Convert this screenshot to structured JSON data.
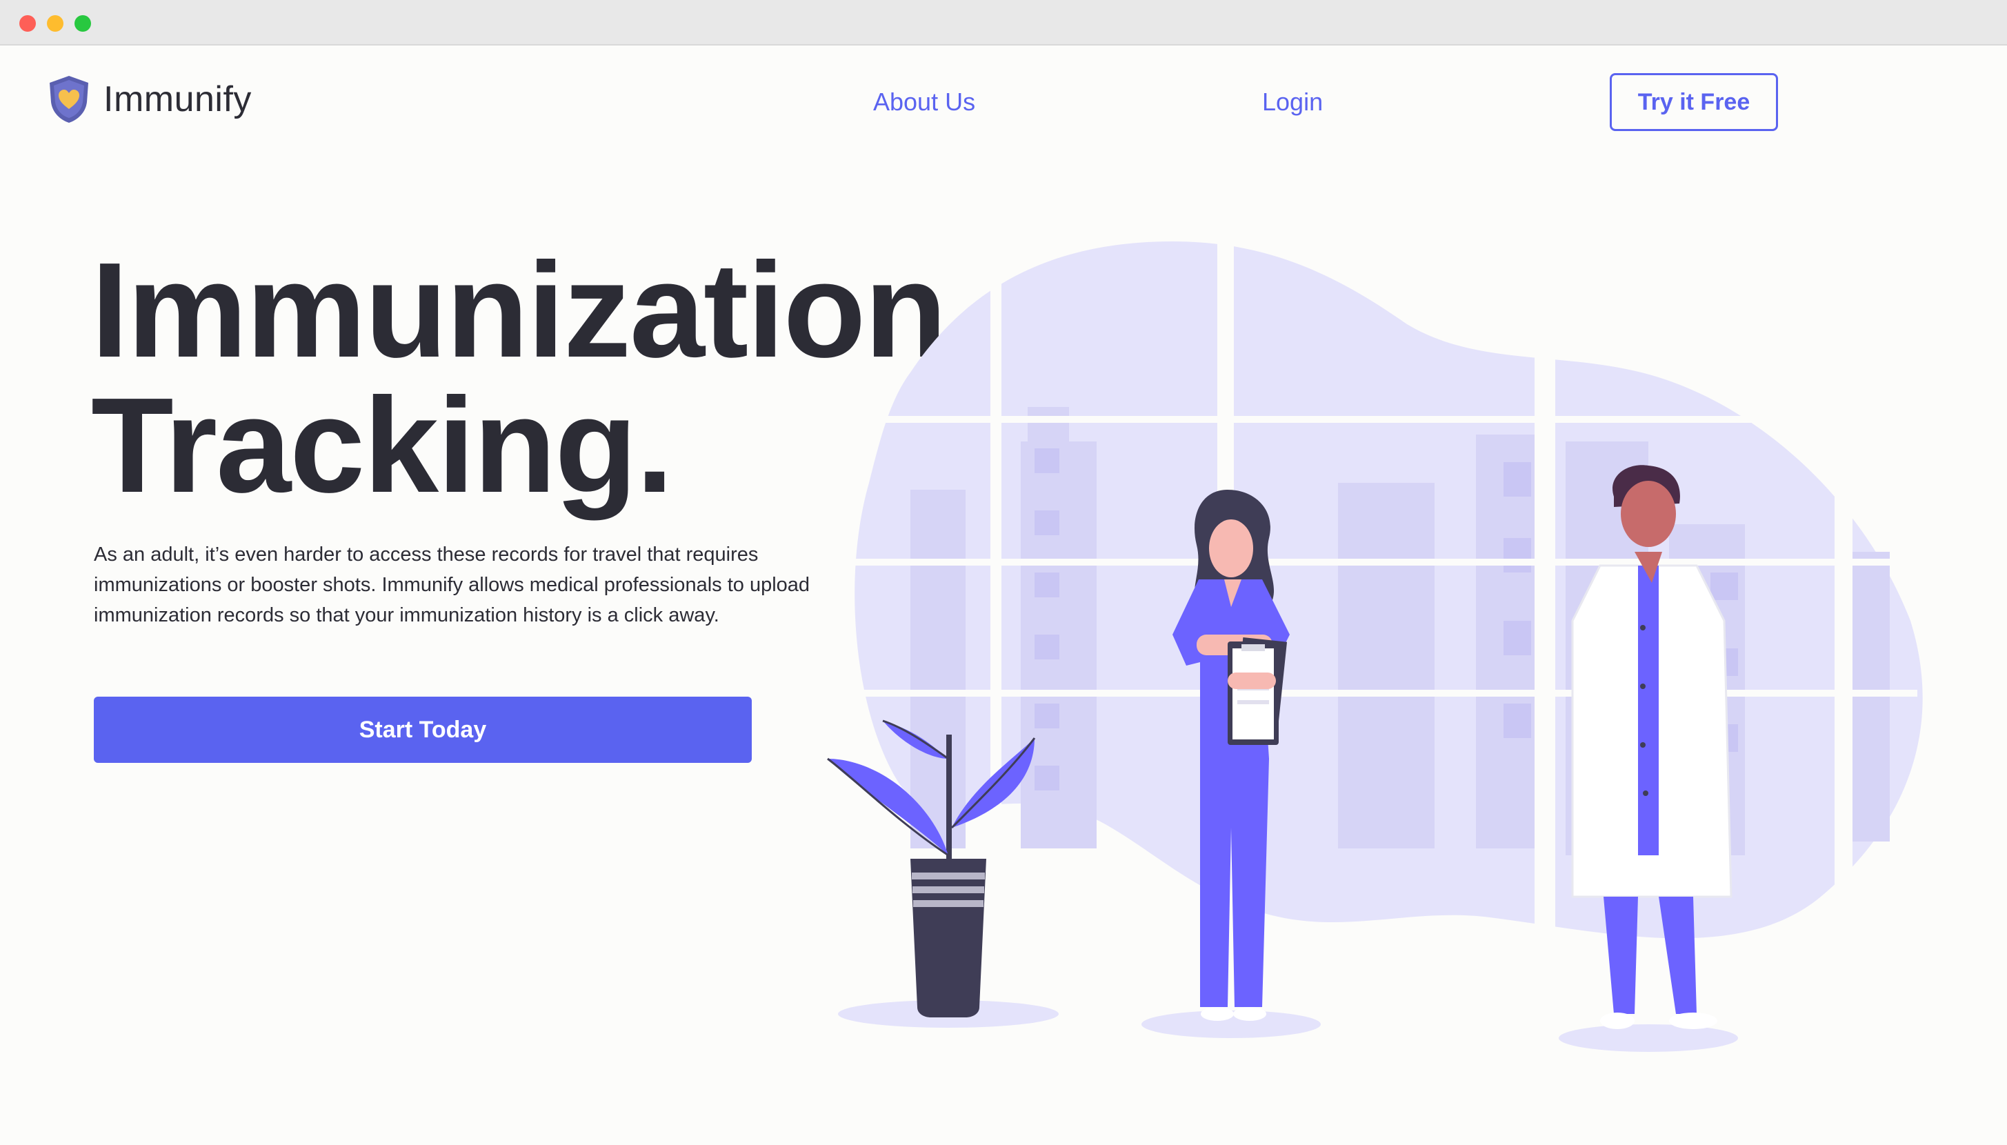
{
  "window": {
    "controls": [
      "close",
      "minimize",
      "maximize"
    ]
  },
  "header": {
    "brand": "Immunify",
    "logo_icon": "shield-heart-icon",
    "nav": {
      "about_label": "About Us",
      "login_label": "Login",
      "try_label": "Try it Free"
    }
  },
  "hero": {
    "headline_line1": "Immunization",
    "headline_line2": "Tracking.",
    "description": "As an adult, it’s even harder to access these records for travel that requires immunizations or booster shots. Immunify allows medical professionals to upload immunization records so that your immunization history is a click away.",
    "cta_label": "Start Today"
  },
  "illustration": {
    "subject": "nurse and doctor standing by a potted plant in front of a window",
    "colors": {
      "accent": "#5a63f0",
      "figure": "#6c63ff",
      "blob": "#e4e3fb",
      "dark": "#3f3d56"
    }
  },
  "colors": {
    "background": "#fcfcfa",
    "accent": "#5a63f0",
    "text": "#2c2c35"
  }
}
